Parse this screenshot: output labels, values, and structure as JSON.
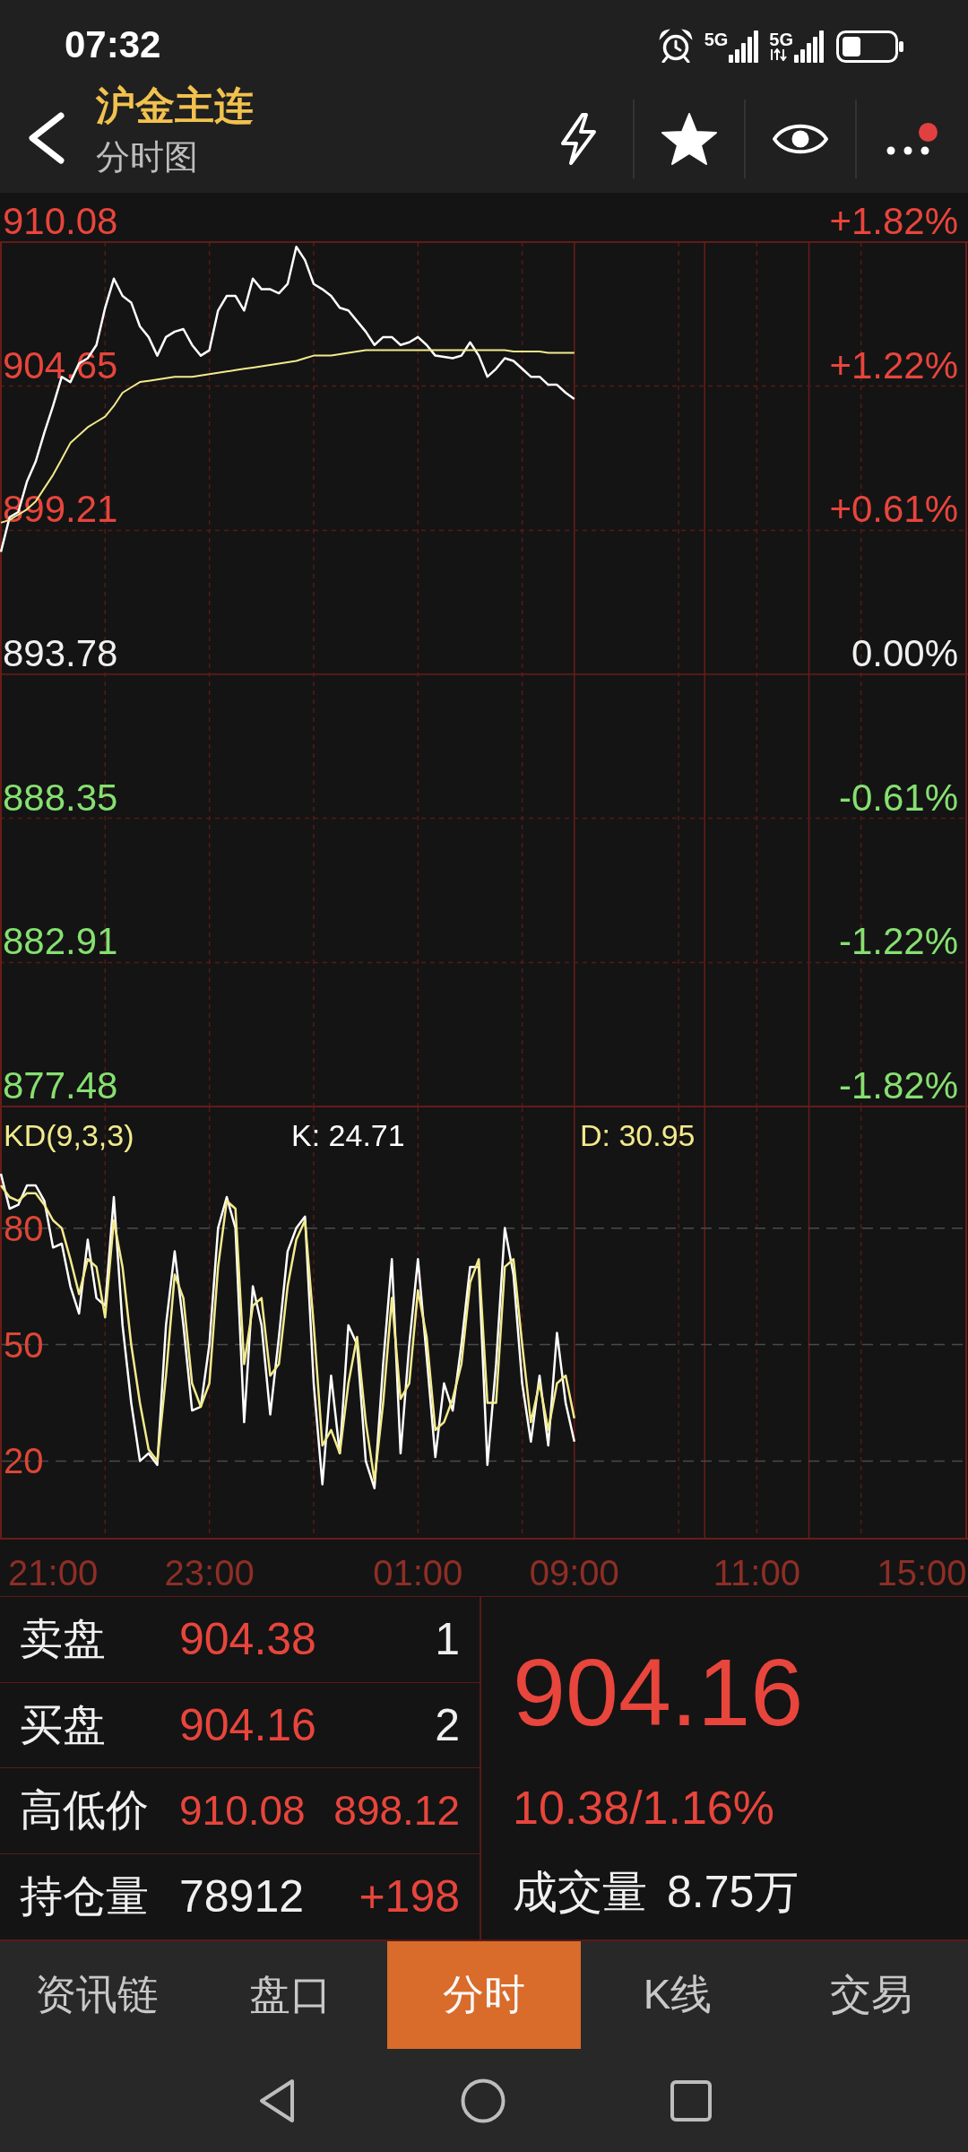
{
  "status_bar": {
    "time": "07:32",
    "signals": [
      {
        "label": "5G",
        "kind": "plain"
      },
      {
        "label": "5G",
        "kind": "data"
      }
    ]
  },
  "header": {
    "title": "沪金主连",
    "subtitle": "分时图",
    "actions": [
      {
        "kind": "flash",
        "badge": false
      },
      {
        "kind": "star",
        "badge": false
      },
      {
        "kind": "eye",
        "badge": false
      },
      {
        "kind": "more",
        "badge": true
      }
    ]
  },
  "price_chart": {
    "chart_data": {
      "type": "line",
      "grid": true,
      "categories": [
        null,
        null,
        null,
        null,
        null,
        null,
        null,
        null,
        null,
        null,
        null,
        null,
        null,
        null,
        null,
        null,
        null,
        null,
        null,
        null,
        null,
        null,
        null,
        null,
        null,
        null,
        null,
        null,
        null,
        null,
        null,
        null,
        null,
        null,
        null,
        null,
        null,
        null,
        null,
        null,
        null,
        null,
        null,
        null,
        null,
        null,
        null,
        null,
        null,
        null,
        null,
        null,
        null,
        null,
        null,
        null,
        null,
        null,
        null,
        null,
        null,
        null,
        null,
        null,
        null,
        null,
        null,
        null,
        null,
        null,
        null,
        null,
        null,
        null,
        null,
        null,
        null,
        null,
        null,
        null,
        null,
        null,
        null,
        null,
        null,
        null,
        null,
        null,
        null,
        null,
        null,
        null,
        null,
        null,
        null,
        null,
        null,
        null,
        null,
        null,
        null,
        null,
        null,
        null,
        null,
        null,
        null,
        null,
        null,
        null,
        null,
        null
      ],
      "ylim": [
        877.48,
        910.08
      ],
      "yticks": [
        {
          "value": 910.08,
          "label": "910.08"
        },
        {
          "value": 904.65,
          "label": "904.65"
        },
        {
          "value": 899.21,
          "label": "899.21"
        },
        {
          "value": 893.78,
          "label": "893.78"
        },
        {
          "value": 888.35,
          "label": "888.35"
        },
        {
          "value": 882.91,
          "label": "882.91"
        },
        {
          "value": 877.48,
          "label": "877.48"
        }
      ],
      "series": [
        {
          "color": "#ffffff",
          "values": [
            898.4,
            899.7,
            899.9,
            901.05,
            901.8,
            902.9,
            903.9,
            905.0,
            904.8,
            905.5,
            905.7,
            906.2,
            907.6,
            908.7,
            908.05,
            907.8,
            906.9,
            906.5,
            905.8,
            906.5,
            906.7,
            906.8,
            906.2,
            905.8,
            906.0,
            907.5,
            908.05,
            908.05,
            907.5,
            908.7,
            908.3,
            908.3,
            908.15,
            908.5,
            909.9,
            909.4,
            908.5,
            908.3,
            908.05,
            907.6,
            907.5,
            907.1,
            906.7,
            906.2,
            906.5,
            906.5,
            906.2,
            906.3,
            906.5,
            906.2,
            905.8,
            905.75,
            905.7,
            905.8,
            906.3,
            905.8,
            905.0,
            905.3,
            905.7,
            905.6,
            905.3,
            905.0,
            905.0,
            904.7,
            904.7,
            904.4,
            904.16,
            null,
            null,
            null,
            null,
            null,
            null,
            null,
            null,
            null,
            null,
            null,
            null,
            null,
            null,
            null,
            null,
            null,
            null,
            null,
            null,
            null,
            null,
            null,
            null,
            null,
            null,
            null,
            null,
            null,
            null,
            null,
            null,
            null,
            null,
            null,
            null,
            null,
            null,
            null,
            null,
            null,
            null,
            null,
            null,
            null
          ]
        },
        {
          "color": "#f3ea8c",
          "values": [
            899.5,
            899.6,
            899.8,
            900.0,
            900.3,
            900.8,
            901.3,
            901.9,
            902.5,
            902.8,
            903.1,
            903.3,
            903.5,
            903.9,
            904.4,
            904.6,
            904.8,
            904.85,
            904.9,
            904.95,
            905.0,
            905.0,
            905.0,
            905.05,
            905.1,
            905.15,
            905.2,
            905.25,
            905.3,
            905.35,
            905.4,
            905.45,
            905.5,
            905.55,
            905.6,
            905.7,
            905.8,
            905.8,
            905.8,
            905.85,
            905.9,
            905.95,
            906.0,
            906.0,
            906.0,
            906.0,
            906.0,
            906.0,
            906.0,
            906.0,
            906.0,
            906.0,
            906.0,
            906.0,
            906.0,
            906.0,
            906.0,
            906.0,
            906.0,
            905.95,
            905.95,
            905.95,
            905.95,
            905.9,
            905.9,
            905.9,
            905.9,
            null,
            null,
            null,
            null,
            null,
            null,
            null,
            null,
            null,
            null,
            null,
            null,
            null,
            null,
            null,
            null,
            null,
            null,
            null,
            null,
            null,
            null,
            null,
            null,
            null,
            null,
            null,
            null,
            null,
            null,
            null,
            null,
            null,
            null,
            null,
            null,
            null,
            null,
            null,
            null,
            null,
            null,
            null,
            null,
            null
          ]
        }
      ]
    },
    "percent_labels": [
      {
        "text": "+1.82%",
        "color": "#e8453c"
      },
      {
        "text": "+1.22%",
        "color": "#e8453c"
      },
      {
        "text": "+0.61%",
        "color": "#e8453c"
      },
      {
        "text": "0.00%",
        "color": "#f0f0f0"
      },
      {
        "text": "-0.61%",
        "color": "#86e070"
      },
      {
        "text": "-1.22%",
        "color": "#86e070"
      },
      {
        "text": "-1.82%",
        "color": "#86e070"
      }
    ]
  },
  "kd_chart": {
    "title": "KD(9,3,3)",
    "readouts": [
      "K: 24.71",
      "D: 30.95"
    ],
    "chart_data": {
      "type": "line",
      "grid": true,
      "categories": [
        null,
        null,
        null,
        null,
        null,
        null,
        "21:00",
        null,
        null,
        null,
        null,
        null,
        null,
        null,
        null,
        null,
        null,
        null,
        null,
        null,
        null,
        null,
        null,
        null,
        "23:00",
        null,
        null,
        null,
        null,
        null,
        null,
        null,
        null,
        null,
        null,
        null,
        null,
        null,
        null,
        null,
        null,
        null,
        null,
        null,
        null,
        null,
        null,
        null,
        "01:00",
        null,
        null,
        null,
        null,
        null,
        null,
        null,
        null,
        null,
        null,
        null,
        null,
        null,
        null,
        null,
        null,
        null,
        "09:00",
        null,
        null,
        null,
        null,
        null,
        null,
        null,
        null,
        null,
        null,
        null,
        null,
        null,
        null,
        null,
        null,
        null,
        null,
        null,
        null,
        "11:00",
        null,
        null,
        null,
        null,
        null,
        null,
        null,
        null,
        null,
        null,
        null,
        null,
        null,
        null,
        null,
        null,
        null,
        null,
        "15:00",
        null,
        null,
        null,
        null,
        null
      ],
      "ylim": [
        0,
        111.1
      ],
      "yticks": [
        {
          "value": 80,
          "label": "80"
        },
        {
          "value": 50,
          "label": "50"
        },
        {
          "value": 20,
          "label": "20"
        }
      ],
      "series": [
        {
          "color": "#ffffff",
          "values": [
            94,
            85,
            86,
            91,
            91,
            87,
            75,
            76,
            65,
            58,
            77,
            62,
            60,
            88,
            55,
            35,
            20,
            22,
            19,
            55,
            74,
            55,
            33,
            34,
            50,
            80,
            88,
            80,
            30,
            65,
            55,
            32,
            52,
            74,
            80,
            83,
            40,
            14,
            42,
            22,
            55,
            50,
            20,
            13,
            45,
            72,
            22,
            50,
            72,
            47,
            21,
            40,
            33,
            50,
            70,
            70,
            19,
            45,
            80,
            68,
            40,
            25,
            42,
            24,
            53,
            35,
            25,
            null,
            null,
            null,
            null,
            null,
            null,
            null,
            null,
            null,
            null,
            null,
            null,
            null,
            null,
            null,
            null,
            null,
            null,
            null,
            null,
            null,
            null,
            null,
            null,
            null,
            null,
            null,
            null,
            null,
            null,
            null,
            null,
            null,
            null,
            null,
            null,
            null,
            null,
            null,
            null,
            null,
            null,
            null,
            null,
            null
          ]
        },
        {
          "color": "#f3ea8c",
          "values": [
            91,
            88,
            87,
            89,
            89,
            86,
            82,
            80,
            72,
            63,
            72,
            70,
            57,
            82,
            70,
            50,
            35,
            23,
            20,
            42,
            68,
            62,
            40,
            34,
            40,
            70,
            87,
            85,
            45,
            60,
            62,
            42,
            45,
            65,
            77,
            82,
            55,
            24,
            28,
            22,
            40,
            52,
            30,
            15,
            35,
            62,
            36,
            40,
            64,
            52,
            28,
            30,
            36,
            45,
            66,
            72,
            35,
            35,
            70,
            72,
            50,
            30,
            40,
            28,
            40,
            42,
            31,
            null,
            null,
            null,
            null,
            null,
            null,
            null,
            null,
            null,
            null,
            null,
            null,
            null,
            null,
            null,
            null,
            null,
            null,
            null,
            null,
            null,
            null,
            null,
            null,
            null,
            null,
            null,
            null,
            null,
            null,
            null,
            null,
            null,
            null,
            null,
            null,
            null,
            null,
            null,
            null,
            null,
            null,
            null,
            null,
            null
          ]
        }
      ]
    }
  },
  "quote": {
    "rows": [
      {
        "kind": "bid_ask",
        "label": "卖盘",
        "price": "904.38",
        "volume": "1"
      },
      {
        "kind": "bid_ask",
        "label": "买盘",
        "price": "904.16",
        "volume": "2"
      },
      {
        "kind": "range",
        "label": "高低价",
        "high": "910.08",
        "low": "898.12"
      },
      {
        "kind": "open_interest",
        "label": "持仓量",
        "value": "78912",
        "change": "+198"
      }
    ],
    "last_price": "904.16",
    "change": "10.38/1.16%",
    "volume_label": "成交量",
    "volume": "8.75万"
  },
  "tabs": [
    {
      "label": "资讯链",
      "selected": false
    },
    {
      "label": "盘口",
      "selected": false
    },
    {
      "label": "分时",
      "selected": true
    },
    {
      "label": "K线",
      "selected": false
    },
    {
      "label": "交易",
      "selected": false
    }
  ]
}
